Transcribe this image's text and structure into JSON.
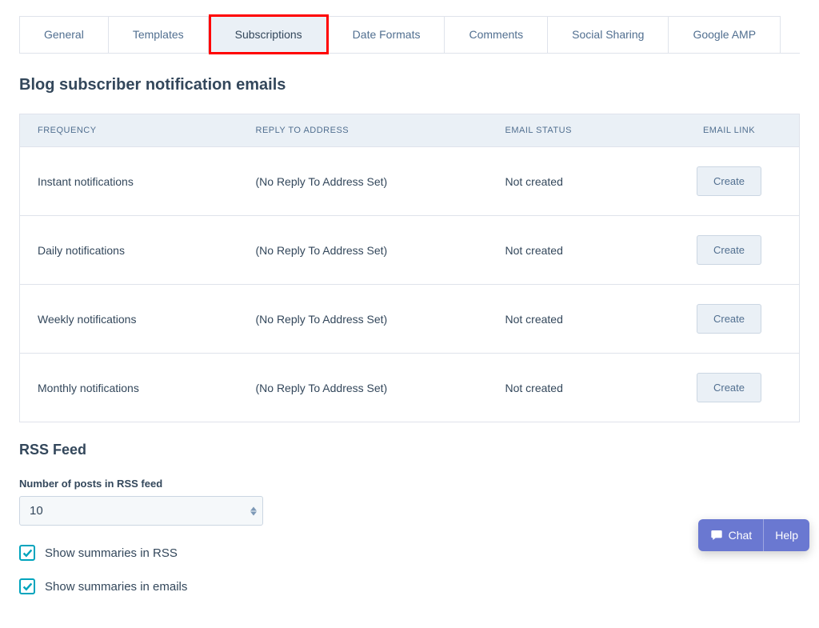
{
  "tabs": {
    "items": [
      {
        "label": "General"
      },
      {
        "label": "Templates"
      },
      {
        "label": "Subscriptions"
      },
      {
        "label": "Date Formats"
      },
      {
        "label": "Comments"
      },
      {
        "label": "Social Sharing"
      },
      {
        "label": "Google AMP"
      }
    ]
  },
  "section": {
    "title": "Blog subscriber notification emails"
  },
  "table": {
    "headers": {
      "freq": "FREQUENCY",
      "reply": "REPLY TO ADDRESS",
      "status": "EMAIL STATUS",
      "link": "EMAIL LINK"
    },
    "rows": [
      {
        "freq": "Instant notifications",
        "reply": "(No Reply To Address Set)",
        "status": "Not created",
        "button": "Create"
      },
      {
        "freq": "Daily notifications",
        "reply": "(No Reply To Address Set)",
        "status": "Not created",
        "button": "Create"
      },
      {
        "freq": "Weekly notifications",
        "reply": "(No Reply To Address Set)",
        "status": "Not created",
        "button": "Create"
      },
      {
        "freq": "Monthly notifications",
        "reply": "(No Reply To Address Set)",
        "status": "Not created",
        "button": "Create"
      }
    ]
  },
  "rss": {
    "title": "RSS Feed",
    "posts_label": "Number of posts in RSS feed",
    "posts_value": "10",
    "checkbox1": "Show summaries in RSS",
    "checkbox2": "Show summaries in emails"
  },
  "widget": {
    "chat": "Chat",
    "help": "Help"
  }
}
